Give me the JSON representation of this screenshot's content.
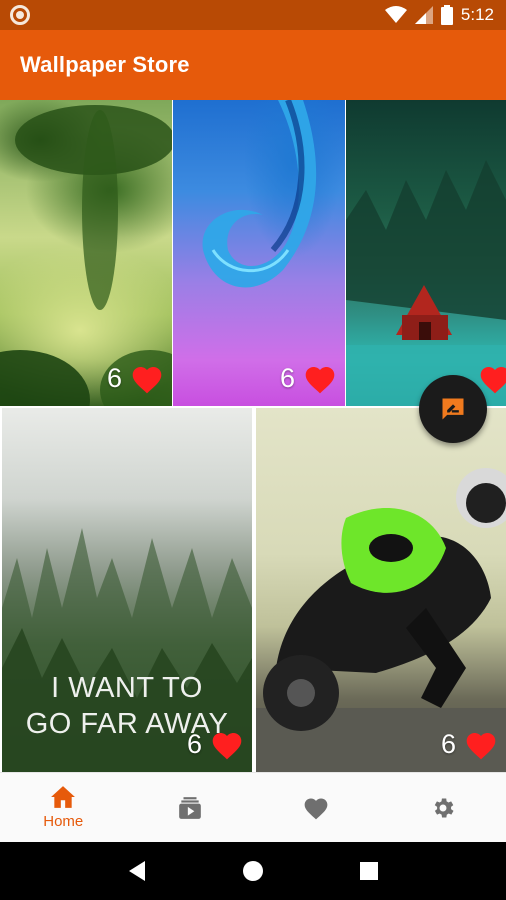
{
  "status_bar": {
    "time": "5:12"
  },
  "app_bar": {
    "title": "Wallpaper Store"
  },
  "wallpapers": [
    {
      "likes": "6"
    },
    {
      "likes": "6"
    },
    {
      "likes": ""
    },
    {
      "likes": "6",
      "overlay_text": [
        "I WANT TO",
        "GO FAR AWAY"
      ]
    },
    {
      "likes": "6"
    }
  ],
  "bottom_nav": {
    "items": [
      {
        "label": "Home",
        "icon": "home-icon",
        "active": true
      },
      {
        "label": "",
        "icon": "subscriptions-icon",
        "active": false
      },
      {
        "label": "",
        "icon": "favorite-icon",
        "active": false
      },
      {
        "label": "",
        "icon": "settings-icon",
        "active": false
      }
    ]
  },
  "colors": {
    "status_bar": "#b84a05",
    "app_bar": "#e65a0b",
    "accent": "#e65a0b",
    "heart": "#ff1f1f",
    "fab": "#1b1b1b",
    "nav_icon_inactive": "#6f6f6f"
  }
}
